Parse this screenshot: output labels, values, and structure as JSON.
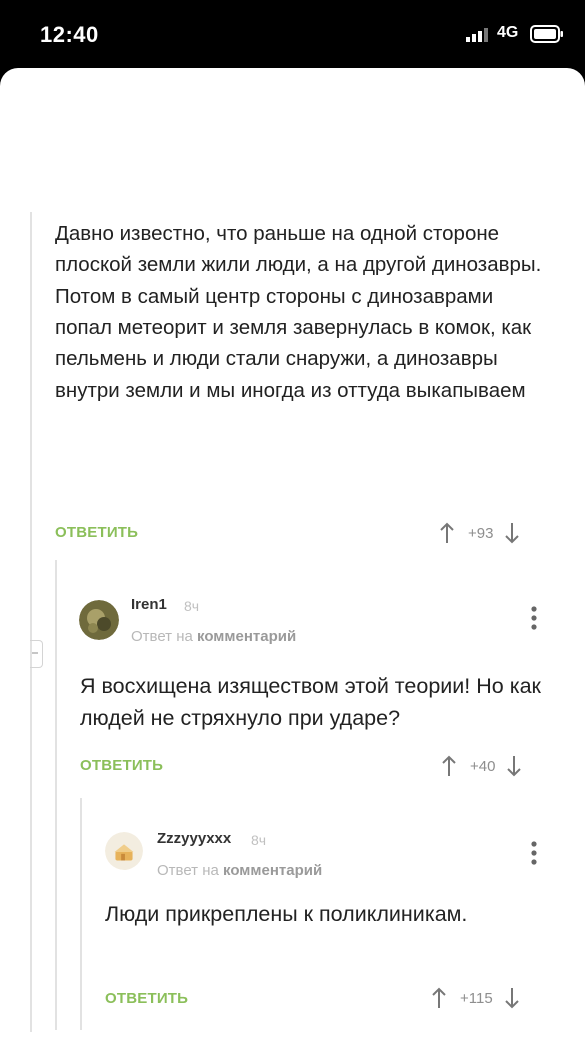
{
  "status_bar": {
    "time": "12:40",
    "network": "4G"
  },
  "comments": [
    {
      "text": "Давно известно, что раньше на одной стороне плоской земли жили люди, а на другой динозавры. Потом в самый центр стороны с динозаврами попал метеорит и земля завернулась в комок, как пельмень и люди стали снаружи, а динозавры внутри земли и мы иногда из оттуда выкапываем",
      "reply_label": "ОТВЕТИТЬ",
      "score": "+93"
    },
    {
      "username": "Iren1",
      "time_ago": "8ч",
      "reply_to_prefix": "Ответ на",
      "reply_to_target": "комментарий",
      "text": "Я восхищена изяществом этой теории! Но как людей не стряхнуло при ударе?",
      "reply_label": "ОТВЕТИТЬ",
      "score": "+40"
    },
    {
      "username": "Zzzyyyxxx",
      "time_ago": "8ч",
      "reply_to_prefix": "Ответ на",
      "reply_to_target": "комментарий",
      "text": "Люди прикреплены к поликлиникам.",
      "reply_label": "ОТВЕТИТЬ",
      "score": "+115"
    }
  ],
  "icons": {
    "upvote": "arrow-up-icon",
    "downvote": "arrow-down-icon",
    "more": "more-vertical-icon",
    "signal": "signal-icon",
    "battery": "battery-icon"
  },
  "colors": {
    "reply_accent": "#8bbf5a",
    "meta_gray": "#b8b8b8"
  }
}
